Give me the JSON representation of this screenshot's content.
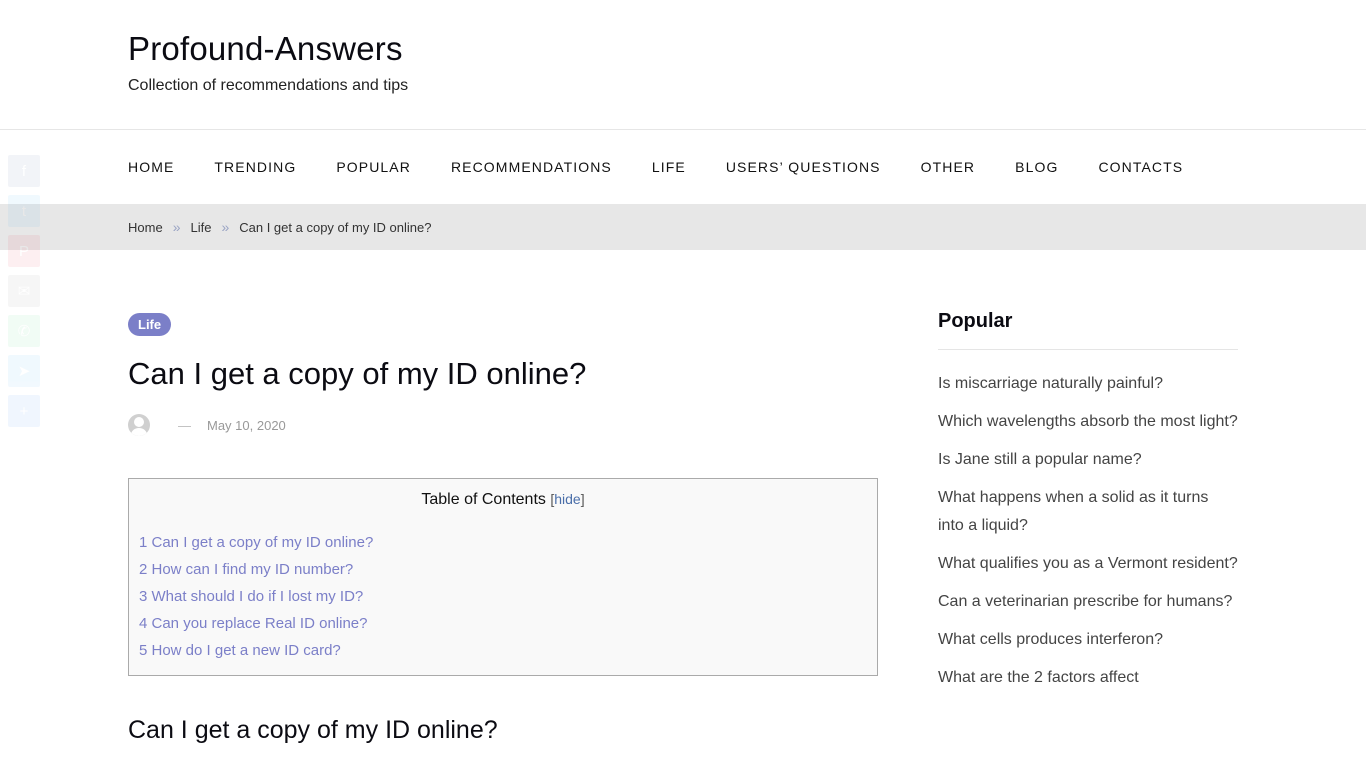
{
  "site": {
    "title": "Profound-Answers",
    "tagline": "Collection of recommendations and tips"
  },
  "nav": {
    "items": [
      {
        "label": "HOME"
      },
      {
        "label": "TRENDING"
      },
      {
        "label": "POPULAR"
      },
      {
        "label": "RECOMMENDATIONS"
      },
      {
        "label": "LIFE"
      },
      {
        "label": "USERS’ QUESTIONS"
      },
      {
        "label": "OTHER"
      },
      {
        "label": "BLOG"
      },
      {
        "label": "CONTACTS"
      }
    ]
  },
  "breadcrumb": {
    "items": [
      "Home",
      "Life",
      "Can I get a copy of my ID online?"
    ],
    "separator": "»"
  },
  "share": {
    "buttons": [
      {
        "name": "facebook",
        "glyph": "f",
        "color": "#3b5998"
      },
      {
        "name": "twitter",
        "glyph": "t",
        "color": "#1da1f2"
      },
      {
        "name": "pinterest",
        "glyph": "P",
        "color": "#e60023"
      },
      {
        "name": "email",
        "glyph": "✉",
        "color": "#777777"
      },
      {
        "name": "whatsapp",
        "glyph": "✆",
        "color": "#25d366"
      },
      {
        "name": "telegram",
        "glyph": "➤",
        "color": "#1da1f2"
      },
      {
        "name": "share",
        "glyph": "+",
        "color": "#1877f2"
      }
    ]
  },
  "post": {
    "category": "Life",
    "category_color": "#7b7fc8",
    "title": "Can I get a copy of my ID online?",
    "date_separator": "—",
    "date": "May 10, 2020"
  },
  "toc": {
    "title": "Table of Contents",
    "hide_open": "[",
    "hide_label": "hide",
    "hide_close": "]",
    "items": [
      "1 Can I get a copy of my ID online?",
      "2 How can I find my ID number?",
      "3 What should I do if I lost my ID?",
      "4 Can you replace Real ID online?",
      "5 How do I get a new ID card?"
    ]
  },
  "section": {
    "heading": "Can I get a copy of my ID online?"
  },
  "sidebar": {
    "title": "Popular",
    "items": [
      "Is miscarriage naturally painful?",
      "Which wavelengths absorb the most light?",
      "Is Jane still a popular name?",
      "What happens when a solid as it turns into a liquid?",
      "What qualifies you as a Vermont resident?",
      "Can a veterinarian prescribe for humans?",
      "What cells produces interferon?",
      "What are the 2 factors affect"
    ]
  }
}
